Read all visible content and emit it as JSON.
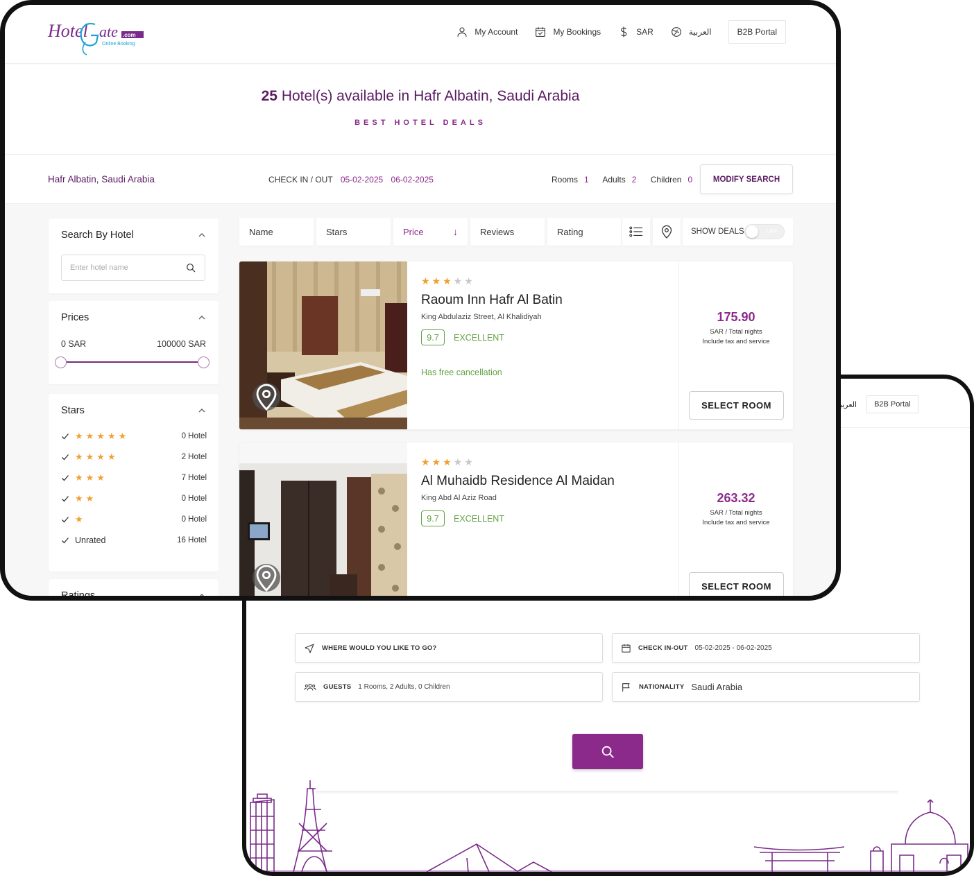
{
  "colors": {
    "brand": "#8b2a8b",
    "brand_dark": "#5a1a62",
    "success": "#62a044",
    "star": "#f0a030"
  },
  "brand": {
    "logo_main": "HotelGate",
    "logo_suffix": ".com",
    "logo_tagline": "Online Booking"
  },
  "header": {
    "nav": [
      {
        "label": "My Account",
        "icon": "user-icon"
      },
      {
        "label": "My Bookings",
        "icon": "calendar-check-icon"
      },
      {
        "label": "SAR",
        "icon": "dollar-icon"
      },
      {
        "label": "العربية",
        "icon": "globe-icon"
      }
    ],
    "b2b": "B2B Portal"
  },
  "hero": {
    "count": "25",
    "title_rest": "Hotel(s) available in Hafr Albatin, Saudi Arabia",
    "subtitle": "BEST HOTEL DEALS"
  },
  "summary": {
    "destination": "Hafr Albatin, Saudi Arabia",
    "checkin_label": "CHECK IN / OUT",
    "checkin": "05-02-2025",
    "checkout": "06-02-2025",
    "rooms_label": "Rooms",
    "rooms": "1",
    "adults_label": "Adults",
    "adults": "2",
    "children_label": "Children",
    "children": "0",
    "modify": "MODIFY SEARCH"
  },
  "sidebar": {
    "search": {
      "title": "Search By Hotel",
      "placeholder": "Enter hotel name"
    },
    "prices": {
      "title": "Prices",
      "min": "0 SAR",
      "max": "100000 SAR"
    },
    "stars": {
      "title": "Stars",
      "rows": [
        {
          "stars": "★★★★★",
          "count": "0 Hotel"
        },
        {
          "stars": "★★★★",
          "count": "2 Hotel"
        },
        {
          "stars": "★★★",
          "count": "7 Hotel"
        },
        {
          "stars": "★★",
          "count": "0 Hotel"
        },
        {
          "stars": "★",
          "count": "0 Hotel"
        },
        {
          "stars": "Unrated",
          "count": "16 Hotel"
        }
      ]
    },
    "ratings": {
      "title": "Ratings"
    }
  },
  "sortbar": {
    "tabs": [
      "Name",
      "Stars",
      "Price",
      "Reviews",
      "Rating"
    ],
    "active": "Price",
    "sort_arrow": "↓",
    "show_deals": "SHOW DEALS",
    "toggle_state": "OFF"
  },
  "hotels": [
    {
      "name": "Raoum Inn Hafr Al Batin",
      "address": "King Abdulaziz Street, Al Khalidiyah",
      "stars": 3,
      "stars_on": "★★★",
      "stars_off": "★★",
      "score": "9.7",
      "score_text": "EXCELLENT",
      "free_cancellation": "Has free cancellation",
      "price": "175.90",
      "unit": "SAR / Total nights",
      "note": "Include tax and service",
      "select": "SELECT ROOM"
    },
    {
      "name": "Al Muhaidb Residence Al Maidan",
      "address": "King Abd Al Aziz Road",
      "stars": 3,
      "stars_on": "★★★",
      "stars_off": "★★",
      "score": "9.7",
      "score_text": "EXCELLENT",
      "free_cancellation": "",
      "price": "263.32",
      "unit": "SAR / Total nights",
      "note": "Include tax and service",
      "select": "SELECT ROOM"
    }
  ],
  "search_form": {
    "header_lang": "العربية",
    "header_b2b": "B2B Portal",
    "destination_label": "WHERE WOULD YOU LIKE TO GO?",
    "dates_label": "CHECK IN-OUT",
    "dates_value": "05-02-2025 - 06-02-2025",
    "guests_label": "GUESTS",
    "guests_value": "1 Rooms, 2 Adults, 0 Children",
    "nationality_label": "NATIONALITY",
    "nationality_value": "Saudi Arabia"
  }
}
